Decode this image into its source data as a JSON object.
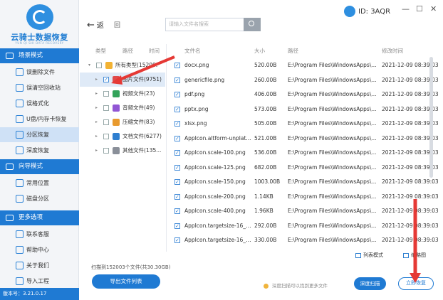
{
  "brand": {
    "name": "云骑士数据恢复",
    "sub": "YUN QI SHI DATA RECOVERY"
  },
  "sidebar": {
    "sections": [
      {
        "title": "场景模式",
        "items": [
          "误删除文件",
          "误清空回收站",
          "误格式化",
          "U盘/内存卡恢复",
          "分区恢复",
          "深度恢复"
        ],
        "active": 4
      },
      {
        "title": "向导模式",
        "items": [
          "常用位置",
          "磁盘分区"
        ]
      },
      {
        "title": "更多选项",
        "items": [
          "联系客服",
          "帮助中心",
          "关于我们",
          "导入工程"
        ]
      }
    ],
    "version": "版本号：3.21.0.17"
  },
  "topbar": {
    "back": "返",
    "refresh": "回",
    "search_placeholder": "请输入文件名搜索",
    "user_id": "ID: 3AQR"
  },
  "tree": {
    "headers": [
      "类型",
      "路径",
      "时间"
    ],
    "rows": [
      {
        "label": "所有类型(15200...",
        "color": "#f2b233"
      },
      {
        "label": "图片文件(9751)",
        "color": "#e04b4b"
      },
      {
        "label": "视频文件(23)",
        "color": "#33a35a"
      },
      {
        "label": "音频文件(49)",
        "color": "#9156d4"
      },
      {
        "label": "压缩文件(83)",
        "color": "#e89a2e"
      },
      {
        "label": "文档文件(6277)",
        "color": "#2e7fd0"
      },
      {
        "label": "其他文件(135...",
        "color": "#8a8f99"
      }
    ]
  },
  "files": {
    "headers": {
      "name": "文件名",
      "size": "大小",
      "path": "路径",
      "time": "修改时间"
    },
    "rows": [
      {
        "name": "docx.png",
        "size": "520.00B",
        "path": "E:\\Program Files\\WindowsApps\\...",
        "time": "2021-12-09 08:39:03"
      },
      {
        "name": "genericfile.png",
        "size": "260.00B",
        "path": "E:\\Program Files\\WindowsApps\\...",
        "time": "2021-12-09 08:39:03"
      },
      {
        "name": "pdf.png",
        "size": "406.00B",
        "path": "E:\\Program Files\\WindowsApps\\...",
        "time": "2021-12-09 08:39:03"
      },
      {
        "name": "pptx.png",
        "size": "573.00B",
        "path": "E:\\Program Files\\WindowsApps\\...",
        "time": "2021-12-09 08:39:03"
      },
      {
        "name": "xlsx.png",
        "size": "505.00B",
        "path": "E:\\Program Files\\WindowsApps\\...",
        "time": "2021-12-09 08:39:03"
      },
      {
        "name": "AppIcon.altform-unplat...",
        "size": "521.00B",
        "path": "E:\\Program Files\\WindowsApps\\...",
        "time": "2021-12-09 08:39:03"
      },
      {
        "name": "AppIcon.scale-100.png",
        "size": "536.00B",
        "path": "E:\\Program Files\\WindowsApps\\...",
        "time": "2021-12-09 08:39:03"
      },
      {
        "name": "AppIcon.scale-125.png",
        "size": "682.00B",
        "path": "E:\\Program Files\\WindowsApps\\...",
        "time": "2021-12-09 08:39:03"
      },
      {
        "name": "AppIcon.scale-150.png",
        "size": "1003.00B",
        "path": "E:\\Program Files\\WindowsApps\\...",
        "time": "2021-12-09 08:39:03"
      },
      {
        "name": "AppIcon.scale-200.png",
        "size": "1.14KB",
        "path": "E:\\Program Files\\WindowsApps\\...",
        "time": "2021-12-09 08:39:03"
      },
      {
        "name": "AppIcon.scale-400.png",
        "size": "1.96KB",
        "path": "E:\\Program Files\\WindowsApps\\...",
        "time": "2021-12-09 08:39:03"
      },
      {
        "name": "AppIcon.targetsize-16_a...",
        "size": "292.00B",
        "path": "E:\\Program Files\\WindowsApps\\...",
        "time": "2021-12-09 08:39:03"
      },
      {
        "name": "AppIcon.targetsize-16_c...",
        "size": "330.00B",
        "path": "E:\\Program Files\\WindowsApps\\...",
        "time": "2021-12-09 08:39:03"
      },
      {
        "name": "AppIcon.targetsize-24_a...",
        "size": "375.00B",
        "path": "E:\\Program Files\\WindowsApps\\...",
        "time": "2021-12-09 08:39:03"
      }
    ]
  },
  "bottom": {
    "status": "扫描到152003个文件(共30.30GB)",
    "export": "导出文件列表",
    "tip": "深度扫描可以找到更多文件",
    "deep_scan": "深度扫描",
    "recover": "立即恢复",
    "list_view": "列表模式",
    "thumb_view": "缩略图"
  },
  "colors": {
    "accent": "#1f7ad3",
    "highlight": "#e53935"
  }
}
